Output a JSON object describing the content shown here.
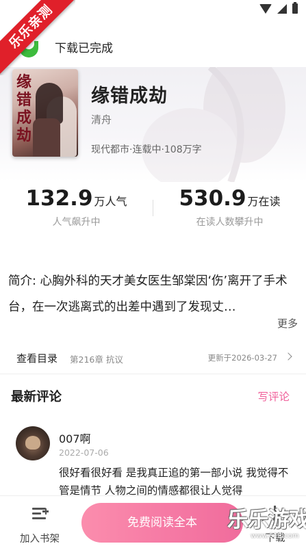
{
  "ribbon": {
    "text": "乐乐亲测"
  },
  "download_bar": {
    "text": "下载已完成"
  },
  "book": {
    "title": "缘错成劫",
    "cover_title": "缘错成劫",
    "author": "清舟",
    "meta": "现代都市·连载中·108万字"
  },
  "stats": {
    "popularity": {
      "value": "132.9",
      "unit": "万人气",
      "label": "人气飙升中"
    },
    "reading": {
      "value": "530.9",
      "unit": "万在读",
      "label": "在读人数攀升中"
    }
  },
  "intro": {
    "text": "简介: 心胸外科的天才美女医生邹棠因‘伤’离开了手术台，在一次逃离式的出差中遇到了发现丈…",
    "more_label": "更多"
  },
  "catalog": {
    "label": "查看目录",
    "latest_chapter": "第216章 抗议",
    "updated": "更新于2026-03-27"
  },
  "comments": {
    "title": "最新评论",
    "write_label": "写评论",
    "items": [
      {
        "user": "007啊",
        "date": "2022-07-06",
        "text": "很好看很好看 是我真正追的第一部小说 我觉得不管是情节 人物之间的情感都很让人觉得"
      }
    ]
  },
  "bottom_bar": {
    "add_shelf_label": "加入书架",
    "read_label": "免费阅读全本",
    "download_label": "下载"
  },
  "watermark": {
    "text": "乐乐游戏",
    "url": "www.61R.com"
  },
  "colors": {
    "accent_pink": "#f06c9c",
    "ribbon_red": "#e0202a",
    "logo_green": "#3dbb3d"
  }
}
